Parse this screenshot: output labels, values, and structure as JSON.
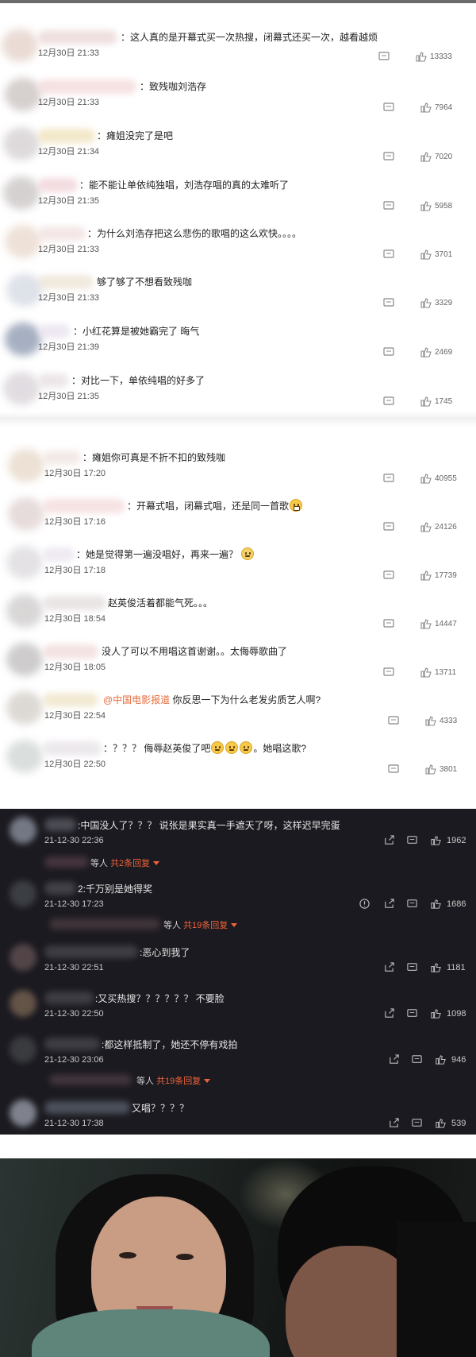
{
  "block1": [
    {
      "text": "：这人真的是开幕式买一次热搜，闭幕式还买一次，越看越烦",
      "time": "12月30日 21:33",
      "likes": "13333"
    },
    {
      "text": "：致残咖刘浩存",
      "time": "12月30日 21:33",
      "likes": "7964"
    },
    {
      "text": "：瘫姐没完了是吧",
      "time": "12月30日 21:34",
      "likes": "7020"
    },
    {
      "text": "：能不能让单依纯独唱，刘浩存唱的真的太难听了",
      "time": "12月30日 21:35",
      "likes": "5958"
    },
    {
      "text": "：为什么刘浩存把这么悲伤的歌唱的这么欢快。。。。",
      "time": "12月30日 21:33",
      "likes": "3701"
    },
    {
      "text": "够了够了不想看致残咖",
      "time": "12月30日 21:33",
      "likes": "3329"
    },
    {
      "text": "：小红花算是被她霸完了 晦气",
      "time": "12月30日 21:39",
      "likes": "2469"
    },
    {
      "text": "：对比一下，单依纯唱的好多了",
      "time": "12月30日 21:35",
      "likes": "1745"
    }
  ],
  "block2": [
    {
      "text": "：瘫姐你可真是不折不扣的致残咖",
      "time": "12月30日 17:20",
      "likes": "40955"
    },
    {
      "text": "：开幕式唱，闭幕式唱，还是同一首歌",
      "time": "12月30日 17:16",
      "likes": "24126"
    },
    {
      "text": "：她是觉得第一遍没唱好，再来一遍？",
      "time": "12月30日 17:18",
      "likes": "17739"
    },
    {
      "text": "赵英俊活着都能气死。。。",
      "time": "12月30日 18:54",
      "likes": "14447"
    },
    {
      "text": "没人了可以不用唱这首谢谢。。太侮辱歌曲了",
      "time": "12月30日 18:05",
      "likes": "13711"
    },
    {
      "mention": "@中国电影报道",
      "text": " 你反思一下为什么老发劣质艺人啊?",
      "time": "12月30日 22:54",
      "likes": "4333"
    },
    {
      "text": "：？？？ 侮辱赵英俊了吧",
      "text_after": "。她唱这歌?",
      "time": "12月30日 22:50",
      "likes": "3801"
    }
  ],
  "dark": [
    {
      "text": ":中国没人了？？？ 说张是果实真一手遮天了呀，这样迟早完蛋",
      "time": "21-12-30 22:36",
      "likes": "1962",
      "replies_prefix": "等人",
      "replies_count": "共2条回复"
    },
    {
      "text": "2:千万别是她得奖",
      "time": "21-12-30 17:23",
      "likes": "1686",
      "replies_prefix": "等人",
      "replies_count": "共19条回复"
    },
    {
      "text": ":恶心到我了",
      "time": "21-12-30 22:51",
      "likes": "1181"
    },
    {
      "text": ":又买热搜？？？？？？ 不要脸",
      "time": "21-12-30 22:50",
      "likes": "1098"
    },
    {
      "text": ":都这样抵制了，她还不停有戏拍",
      "time": "21-12-30 23:06",
      "likes": "946",
      "replies_prefix": "等人",
      "replies_count": "共19条回复"
    },
    {
      "text": "又唱？？？？",
      "time": "21-12-30 17:38",
      "likes": "539"
    }
  ],
  "colors": {
    "mention": "#e86b3b",
    "reply_accent": "#f0633a",
    "dark_bg": "#1b1a20"
  },
  "icons": [
    "comment-icon",
    "like-icon",
    "share-icon",
    "report-icon",
    "emoji-grin",
    "emoji-tear",
    "emoji-smile"
  ]
}
